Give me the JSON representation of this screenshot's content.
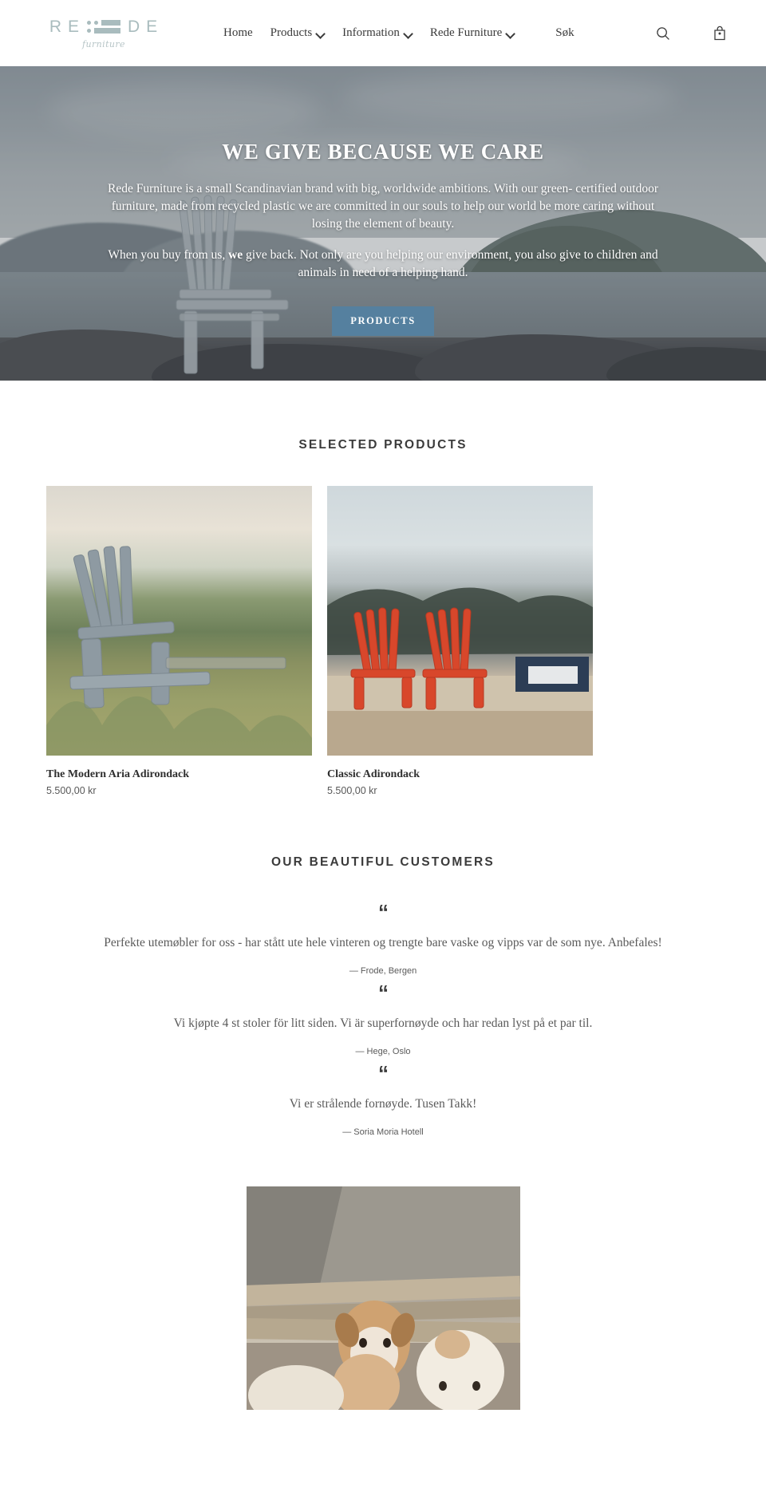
{
  "header": {
    "logo": {
      "letters": [
        "R",
        "E",
        "D",
        "E"
      ],
      "subtitle": "furniture"
    },
    "nav": [
      {
        "label": "Home",
        "has_dropdown": false
      },
      {
        "label": "Products",
        "has_dropdown": true
      },
      {
        "label": "Information",
        "has_dropdown": true
      },
      {
        "label": "Rede Furniture",
        "has_dropdown": true
      }
    ],
    "search_label": "Søk",
    "icons": {
      "search": "search-icon",
      "cart": "bag-icon"
    }
  },
  "hero": {
    "title": "WE GIVE BECAUSE WE CARE",
    "paragraph1_a": "Rede Furniture is a small Scandinavian brand with big, worldwide ambitions. With our green- certified outdoor furniture, made from recycled plastic we are committed in our souls to help our world be more caring without losing the element of beauty.",
    "paragraph2_pre": "When you buy from us, ",
    "paragraph2_bold": "we",
    "paragraph2_post": " give back. Not only are you helping our environment, you also give to children and animals in need of a helping hand.",
    "button_label": "PRODUCTS",
    "button_color": "#55809f"
  },
  "products": {
    "title": "SELECTED PRODUCTS",
    "items": [
      {
        "name": "The Modern Aria Adirondack",
        "price": "5.500,00 kr"
      },
      {
        "name": "Classic Adirondack",
        "price": "5.500,00 kr"
      }
    ]
  },
  "testimonials": {
    "title": "OUR BEAUTIFUL CUSTOMERS",
    "quote_mark": "“",
    "items": [
      {
        "text": "Perfekte utemøbler for oss - har stått ute hele vinteren og trengte bare vaske og vipps var de som nye. Anbefales!",
        "author": "— Frode, Bergen"
      },
      {
        "text": "Vi kjøpte 4 st stoler för litt siden. Vi är superfornøyde och har redan lyst på et par til.",
        "author": "— Hege, Oslo"
      },
      {
        "text": "Vi er strålende fornøyde. Tusen Takk!",
        "author": "— Soria Moria Hotell"
      }
    ]
  },
  "bottom_image": {
    "alt": "puppies-photo"
  }
}
